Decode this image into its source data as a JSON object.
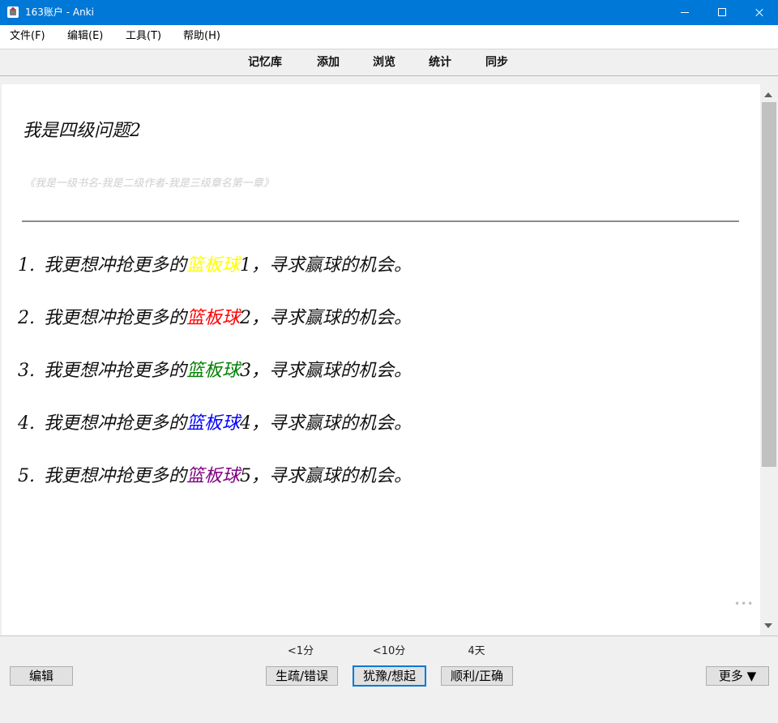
{
  "window": {
    "title": "163账户 - Anki",
    "icon": "anki-app-icon",
    "controls": [
      "minimize-icon",
      "maximize-icon",
      "close-icon"
    ]
  },
  "menu": [
    {
      "label": "文件(F)"
    },
    {
      "label": "编辑(E)"
    },
    {
      "label": "工具(T)"
    },
    {
      "label": "帮助(H)"
    }
  ],
  "toolbar": [
    {
      "label": "记忆库"
    },
    {
      "label": "添加"
    },
    {
      "label": "浏览"
    },
    {
      "label": "统计"
    },
    {
      "label": "同步"
    }
  ],
  "card": {
    "question": "我是四级问题2",
    "source": "《我是一级书名-我是二级作者-我是三级章名第一章》",
    "answers": [
      {
        "num": "1.",
        "before": "我更想冲抢更多的",
        "highlight": "篮板球",
        "after": "1，寻求赢球的机会。",
        "color": "#ffff00"
      },
      {
        "num": "2.",
        "before": "我更想冲抢更多的",
        "highlight": "篮板球",
        "after": "2，寻求赢球的机会。",
        "color": "#ff0000"
      },
      {
        "num": "3.",
        "before": "我更想冲抢更多的",
        "highlight": "篮板球",
        "after": "3，寻求赢球的机会。",
        "color": "#008000"
      },
      {
        "num": "4.",
        "before": "我更想冲抢更多的",
        "highlight": "篮板球",
        "after": "4，寻求赢球的机会。",
        "color": "#0000ff"
      },
      {
        "num": "5.",
        "before": "我更想冲抢更多的",
        "highlight": "篮板球",
        "after": "5，寻求赢球的机会。",
        "color": "#800080"
      }
    ],
    "more_icon": "ellipsis-icon"
  },
  "bottom": {
    "edit_label": "编辑",
    "more_label": "更多 ▼",
    "answer_buttons": [
      {
        "interval": "<1分",
        "label": "生疏/错误"
      },
      {
        "interval": "<10分",
        "label": "犹豫/想起"
      },
      {
        "interval": "4天",
        "label": "顺利/正确"
      }
    ]
  },
  "colors": {
    "titlebar": "#0078d7",
    "focus_border": "#0078d7"
  }
}
